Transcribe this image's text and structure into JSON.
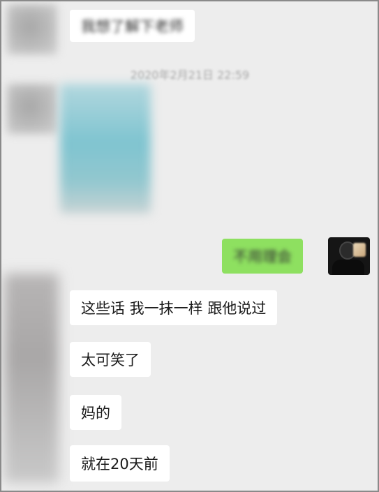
{
  "chat": {
    "timestamp": "2020年2月21日 22:59",
    "messages": [
      {
        "side": "left",
        "type": "text",
        "text": "我想了解下老师"
      },
      {
        "side": "left",
        "type": "image"
      },
      {
        "side": "right",
        "type": "text",
        "text": "不用理会"
      },
      {
        "side": "left",
        "type": "text",
        "text": "这些话 我一抹一样 跟他说过"
      },
      {
        "side": "left",
        "type": "text",
        "text": "太可笑了"
      },
      {
        "side": "left",
        "type": "text",
        "text": "妈的"
      },
      {
        "side": "left",
        "type": "text",
        "text": "就在20天前"
      }
    ]
  },
  "colors": {
    "chat_background": "#ededed",
    "bubble_left": "#ffffff",
    "bubble_right": "#8ee060"
  }
}
